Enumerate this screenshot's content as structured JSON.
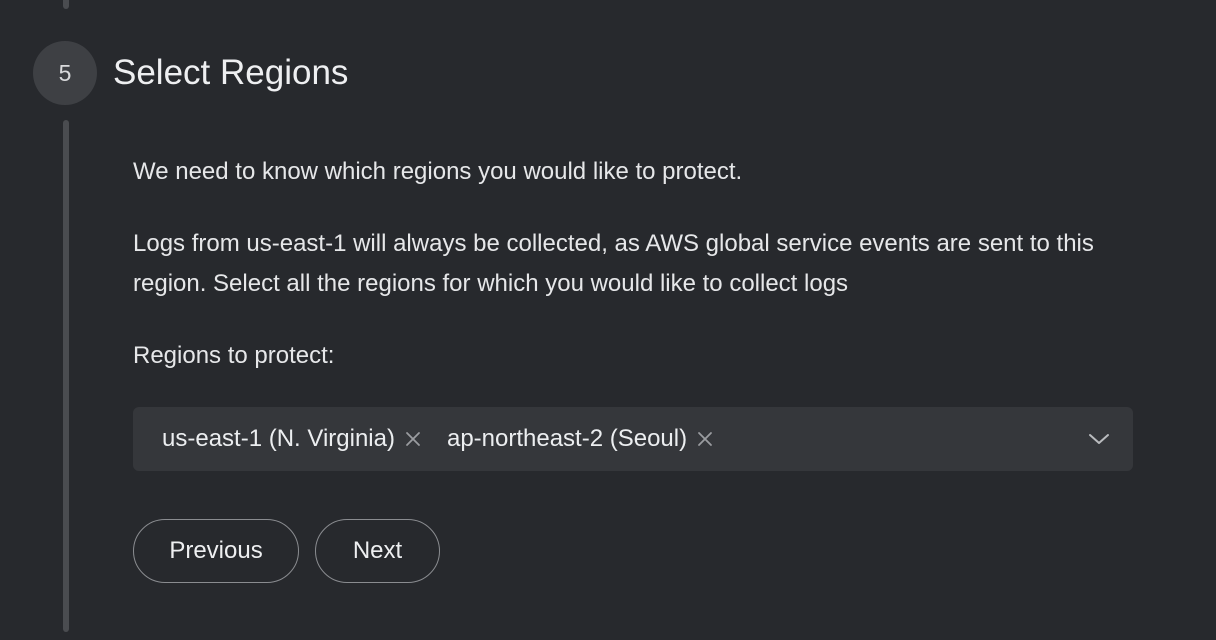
{
  "step": {
    "number": "5",
    "title": "Select Regions"
  },
  "content": {
    "intro": "We need to know which regions you would like to protect.",
    "detail": "Logs from us-east-1 will always be collected, as AWS global service events are sent to this region. Select all the regions for which you would like to collect logs",
    "regions_label": "Regions to protect:"
  },
  "regions_select": {
    "selected": [
      {
        "label": "us-east-1 (N. Virginia)"
      },
      {
        "label": "ap-northeast-2 (Seoul)"
      }
    ],
    "remove_icon": "close-icon",
    "dropdown_icon": "chevron-down-icon"
  },
  "actions": {
    "previous_label": "Previous",
    "next_label": "Next"
  },
  "colors": {
    "background": "#27292d",
    "step_circle": "#3e4044",
    "rail": "#4a4c50",
    "select_bg": "#35373b",
    "button_border": "#8a8c90",
    "text": "#e6e7e9"
  }
}
